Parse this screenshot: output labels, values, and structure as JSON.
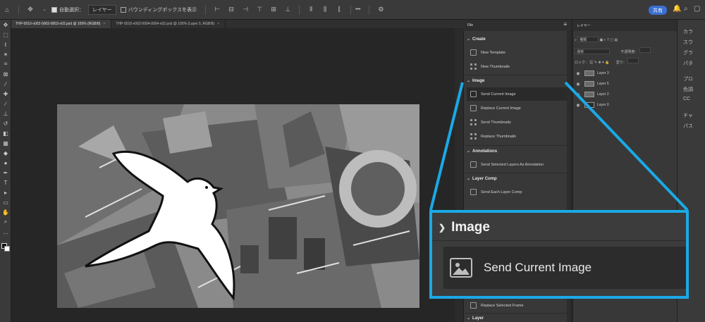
{
  "options_bar": {
    "auto_select_label": "自動選択：",
    "layer_dropdown": "レイヤー",
    "bounding_box_label": "バウンディングボックスを表示",
    "more_label": "•••",
    "share_label": "共有"
  },
  "doc_tabs": [
    {
      "label": "THP-0010-v002-0003-0003-v02.psd @ 100% (RGB/8)",
      "close": "×"
    },
    {
      "label": "THP-0010-v002-0004-0004-v02.psd @ 100% (Layer 5, RGB/8)",
      "close": "×"
    }
  ],
  "plugin_panel": {
    "tab_label": "File",
    "sections": {
      "create": "Create",
      "image": "Image",
      "annotations": "Annotations",
      "layer_comp": "Layer Comp",
      "layer": "Layer"
    },
    "items": {
      "new_template": "New Template",
      "new_thumbnails": "New Thumbnails",
      "send_current_image": "Send Current Image",
      "replace_current_image": "Replace Current Image",
      "send_thumbnails": "Send Thumbnails",
      "replace_thumbnails": "Replace Thumbnails",
      "send_selected_layers_as_annotation": "Send Selected Layers As Annotation",
      "send_each_layer_comp": "Send Each Layer Comp",
      "replace_selected_frame": "Replace Selected Frame"
    }
  },
  "layers_panel": {
    "tab_label": "レイヤー",
    "kind_label": "種類",
    "blend_mode": "通常",
    "opacity_label": "不透明度：",
    "lock_label": "ロック：",
    "fill_label": "塗り：",
    "layers": [
      "Layer 3",
      "Layer 5",
      "Layer 2",
      "Layer 0"
    ]
  },
  "right_strip": {
    "items": [
      "カラ",
      "スウ",
      "グラ",
      "パタ",
      "プロ",
      "色調",
      "CC",
      "チャ",
      "パス"
    ]
  },
  "callout": {
    "section_label": "Image",
    "item_label": "Send Current Image"
  },
  "colors": {
    "callout_border": "#1aa9e6",
    "share_button": "#3b6fd1",
    "panel_bg": "#383838"
  }
}
